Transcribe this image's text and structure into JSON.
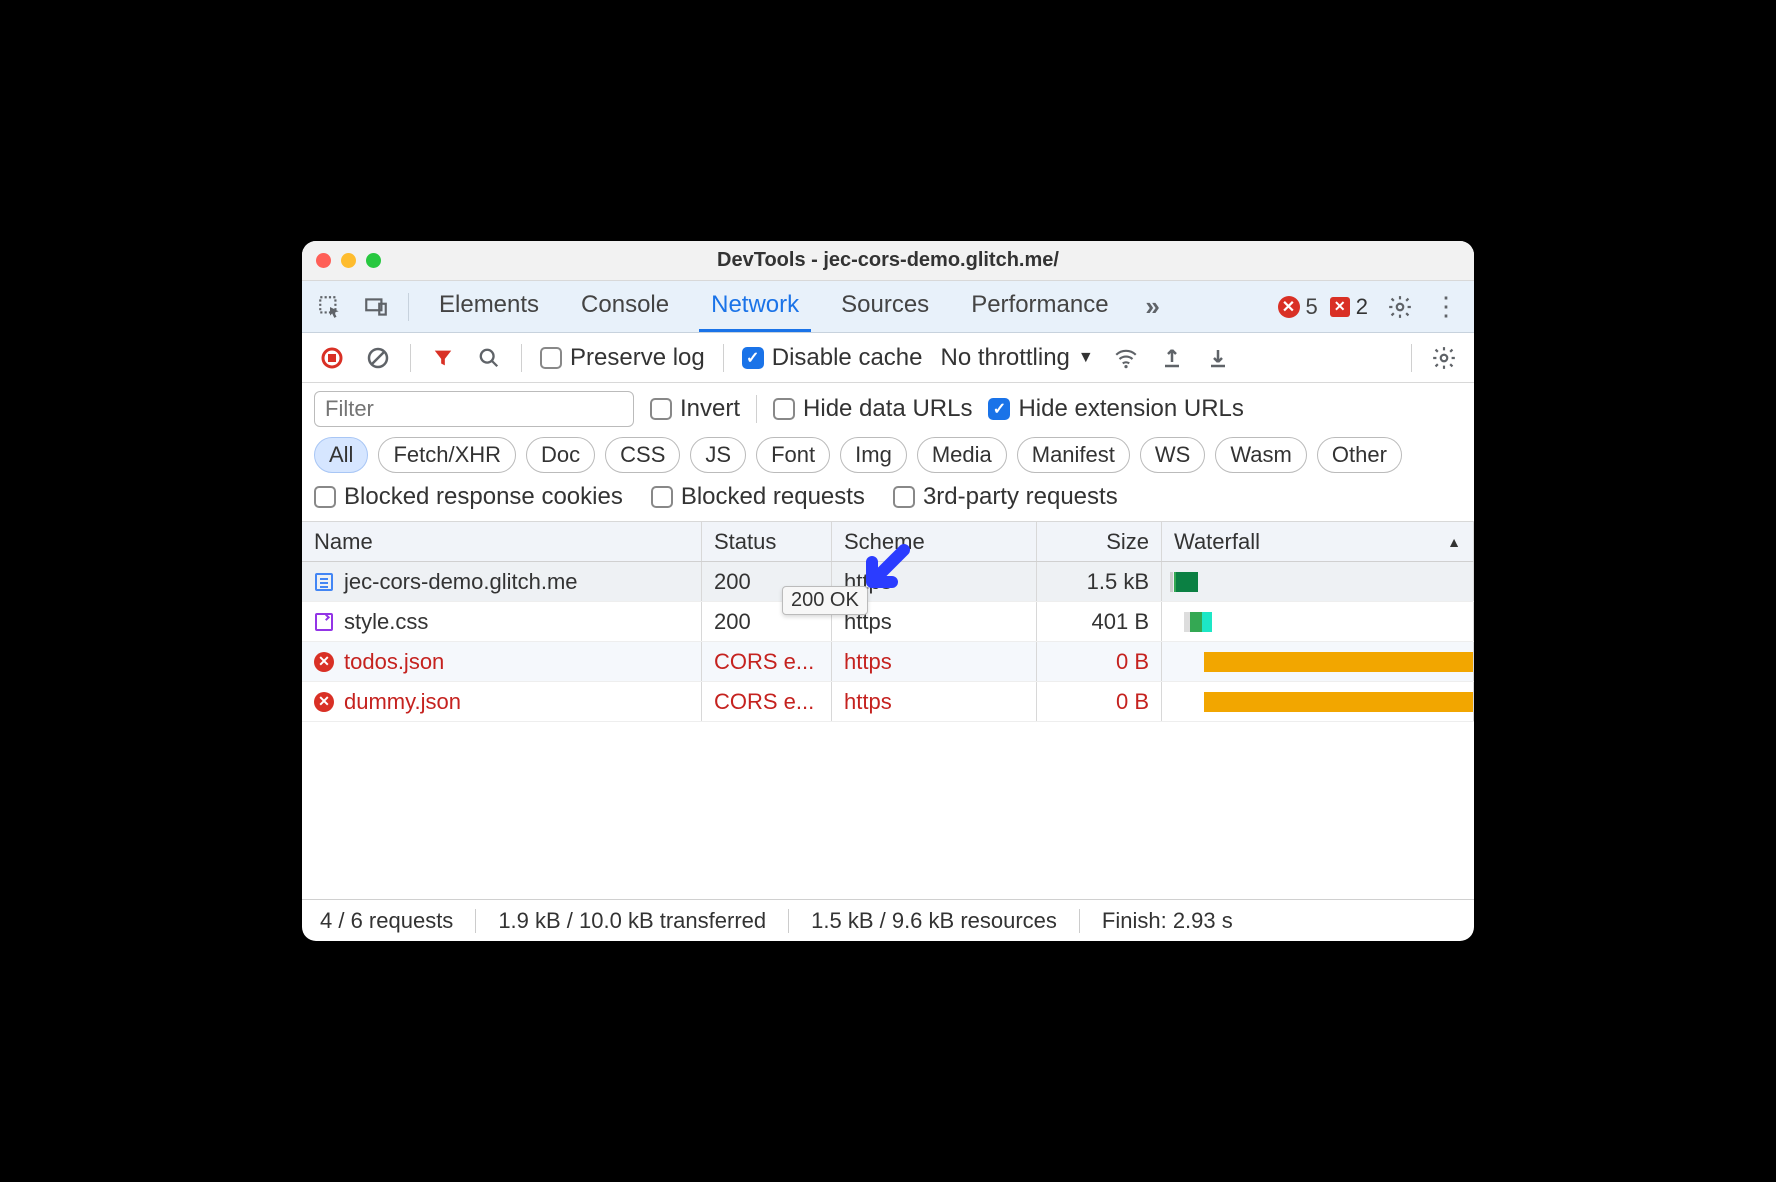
{
  "window": {
    "title": "DevTools - jec-cors-demo.glitch.me/"
  },
  "tabs": {
    "elements": "Elements",
    "console": "Console",
    "network": "Network",
    "sources": "Sources",
    "performance": "Performance"
  },
  "active_tab": "Network",
  "badges": {
    "errors": "5",
    "issues": "2"
  },
  "toolbar": {
    "preserve_log": "Preserve log",
    "disable_cache": "Disable cache",
    "throttling": "No throttling"
  },
  "filterbar": {
    "filter_placeholder": "Filter",
    "invert": "Invert",
    "hide_data_urls": "Hide data URLs",
    "hide_ext_urls": "Hide extension URLs",
    "types": [
      "All",
      "Fetch/XHR",
      "Doc",
      "CSS",
      "JS",
      "Font",
      "Img",
      "Media",
      "Manifest",
      "WS",
      "Wasm",
      "Other"
    ],
    "blocked_cookies": "Blocked response cookies",
    "blocked_requests": "Blocked requests",
    "third_party": "3rd-party requests"
  },
  "columns": {
    "name": "Name",
    "status": "Status",
    "scheme": "Scheme",
    "size": "Size",
    "waterfall": "Waterfall"
  },
  "rows": [
    {
      "name": "jec-cors-demo.glitch.me",
      "status": "200",
      "scheme": "https",
      "size": "1.5 kB",
      "icon": "doc",
      "error": false
    },
    {
      "name": "style.css",
      "status": "200",
      "scheme": "https",
      "size": "401 B",
      "icon": "css",
      "error": false
    },
    {
      "name": "todos.json",
      "status": "CORS e...",
      "scheme": "https",
      "size": "0 B",
      "icon": "err",
      "error": true
    },
    {
      "name": "dummy.json",
      "status": "CORS e...",
      "scheme": "https",
      "size": "0 B",
      "icon": "err",
      "error": true
    }
  ],
  "tooltip": "200 OK",
  "statusbar": {
    "requests": "4 / 6 requests",
    "transferred": "1.9 kB / 10.0 kB transferred",
    "resources": "1.5 kB / 9.6 kB resources",
    "finish": "Finish: 2.93 s"
  }
}
